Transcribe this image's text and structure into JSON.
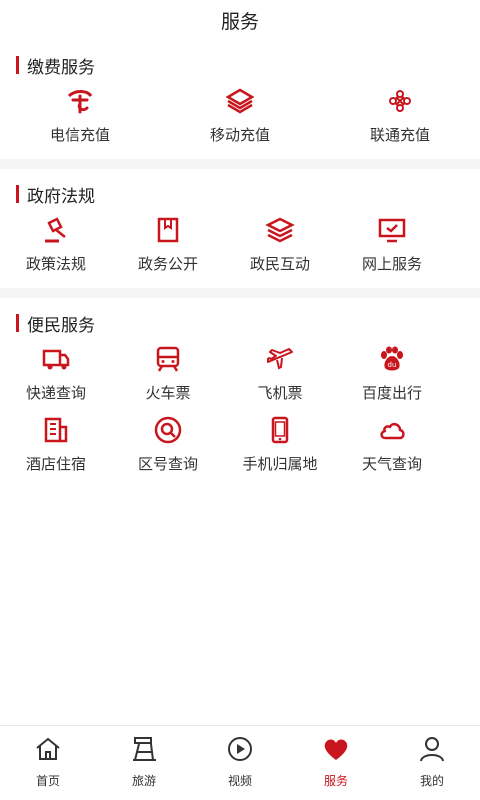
{
  "header": {
    "title": "服务"
  },
  "sections": [
    {
      "title": "缴费服务",
      "items": [
        {
          "label": "电信充值",
          "icon": "telecom-icon"
        },
        {
          "label": "移动充值",
          "icon": "mobile-icon"
        },
        {
          "label": "联通充值",
          "icon": "unicom-icon"
        }
      ]
    },
    {
      "title": "政府法规",
      "items": [
        {
          "label": "政策法规",
          "icon": "gavel-icon"
        },
        {
          "label": "政务公开",
          "icon": "bookmark-icon"
        },
        {
          "label": "政民互动",
          "icon": "layers-icon"
        },
        {
          "label": "网上服务",
          "icon": "monitor-check-icon"
        }
      ]
    },
    {
      "title": "便民服务",
      "items": [
        {
          "label": "快递查询",
          "icon": "truck-icon"
        },
        {
          "label": "火车票",
          "icon": "train-icon"
        },
        {
          "label": "飞机票",
          "icon": "plane-icon"
        },
        {
          "label": "百度出行",
          "icon": "baidu-paw-icon"
        },
        {
          "label": "酒店住宿",
          "icon": "hotel-icon"
        },
        {
          "label": "区号查询",
          "icon": "search-circle-icon"
        },
        {
          "label": "手机归属地",
          "icon": "phone-icon"
        },
        {
          "label": "天气查询",
          "icon": "cloud-icon"
        }
      ]
    }
  ],
  "tabbar": {
    "accent": "#c9151e",
    "tabs": [
      {
        "label": "首页",
        "icon": "home-icon"
      },
      {
        "label": "旅游",
        "icon": "travel-icon"
      },
      {
        "label": "视频",
        "icon": "play-icon"
      },
      {
        "label": "服务",
        "icon": "heart-icon",
        "active": true
      },
      {
        "label": "我的",
        "icon": "user-icon"
      }
    ]
  }
}
